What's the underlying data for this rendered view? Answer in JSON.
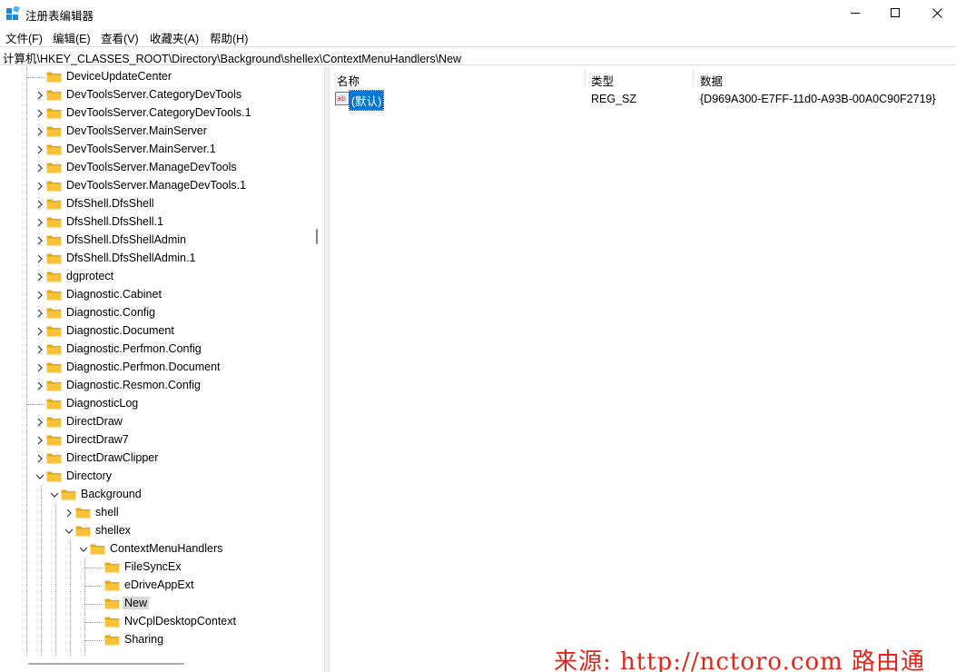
{
  "window": {
    "title": "注册表编辑器",
    "controls": {
      "minimize": "—",
      "maximize": "☐",
      "close": "✕"
    }
  },
  "menu": [
    "文件(F)",
    "编辑(E)",
    "查看(V)",
    "收藏夹(A)",
    "帮助(H)"
  ],
  "address": "计算机\\HKEY_CLASSES_ROOT\\Directory\\Background\\shellex\\ContextMenuHandlers\\New",
  "tree": [
    {
      "label": "DeviceUpdateCenter",
      "depth": 0,
      "expander": "none"
    },
    {
      "label": "DevToolsServer.CategoryDevTools",
      "depth": 0,
      "expander": "collapsed"
    },
    {
      "label": "DevToolsServer.CategoryDevTools.1",
      "depth": 0,
      "expander": "collapsed"
    },
    {
      "label": "DevToolsServer.MainServer",
      "depth": 0,
      "expander": "collapsed"
    },
    {
      "label": "DevToolsServer.MainServer.1",
      "depth": 0,
      "expander": "collapsed"
    },
    {
      "label": "DevToolsServer.ManageDevTools",
      "depth": 0,
      "expander": "collapsed"
    },
    {
      "label": "DevToolsServer.ManageDevTools.1",
      "depth": 0,
      "expander": "collapsed"
    },
    {
      "label": "DfsShell.DfsShell",
      "depth": 0,
      "expander": "collapsed"
    },
    {
      "label": "DfsShell.DfsShell.1",
      "depth": 0,
      "expander": "collapsed"
    },
    {
      "label": "DfsShell.DfsShellAdmin",
      "depth": 0,
      "expander": "collapsed"
    },
    {
      "label": "DfsShell.DfsShellAdmin.1",
      "depth": 0,
      "expander": "collapsed"
    },
    {
      "label": "dgprotect",
      "depth": 0,
      "expander": "collapsed"
    },
    {
      "label": "Diagnostic.Cabinet",
      "depth": 0,
      "expander": "collapsed"
    },
    {
      "label": "Diagnostic.Config",
      "depth": 0,
      "expander": "collapsed"
    },
    {
      "label": "Diagnostic.Document",
      "depth": 0,
      "expander": "collapsed"
    },
    {
      "label": "Diagnostic.Perfmon.Config",
      "depth": 0,
      "expander": "collapsed"
    },
    {
      "label": "Diagnostic.Perfmon.Document",
      "depth": 0,
      "expander": "collapsed"
    },
    {
      "label": "Diagnostic.Resmon.Config",
      "depth": 0,
      "expander": "collapsed"
    },
    {
      "label": "DiagnosticLog",
      "depth": 0,
      "expander": "none"
    },
    {
      "label": "DirectDraw",
      "depth": 0,
      "expander": "collapsed"
    },
    {
      "label": "DirectDraw7",
      "depth": 0,
      "expander": "collapsed"
    },
    {
      "label": "DirectDrawClipper",
      "depth": 0,
      "expander": "collapsed"
    },
    {
      "label": "Directory",
      "depth": 0,
      "expander": "expanded"
    },
    {
      "label": "Background",
      "depth": 1,
      "expander": "expanded"
    },
    {
      "label": "shell",
      "depth": 2,
      "expander": "collapsed"
    },
    {
      "label": "shellex",
      "depth": 2,
      "expander": "expanded"
    },
    {
      "label": "ContextMenuHandlers",
      "depth": 3,
      "expander": "expanded"
    },
    {
      "label": "FileSyncEx",
      "depth": 4,
      "expander": "none"
    },
    {
      "label": "eDriveAppExt",
      "depth": 4,
      "expander": "none"
    },
    {
      "label": "New",
      "depth": 4,
      "expander": "none",
      "selected": true
    },
    {
      "label": "NvCplDesktopContext",
      "depth": 4,
      "expander": "none"
    },
    {
      "label": "Sharing",
      "depth": 4,
      "expander": "none"
    }
  ],
  "list": {
    "columns": [
      "名称",
      "类型",
      "数据"
    ],
    "rows": [
      {
        "name": "(默认)",
        "type": "REG_SZ",
        "data": "{D969A300-E7FF-11d0-A93B-00A0C90F2719}"
      }
    ]
  },
  "watermark": "来源: http://nctoro.com 路由通",
  "colors": {
    "selection": "#0078d7",
    "folder": "#f8c23a",
    "watermark": "#e0251b"
  }
}
